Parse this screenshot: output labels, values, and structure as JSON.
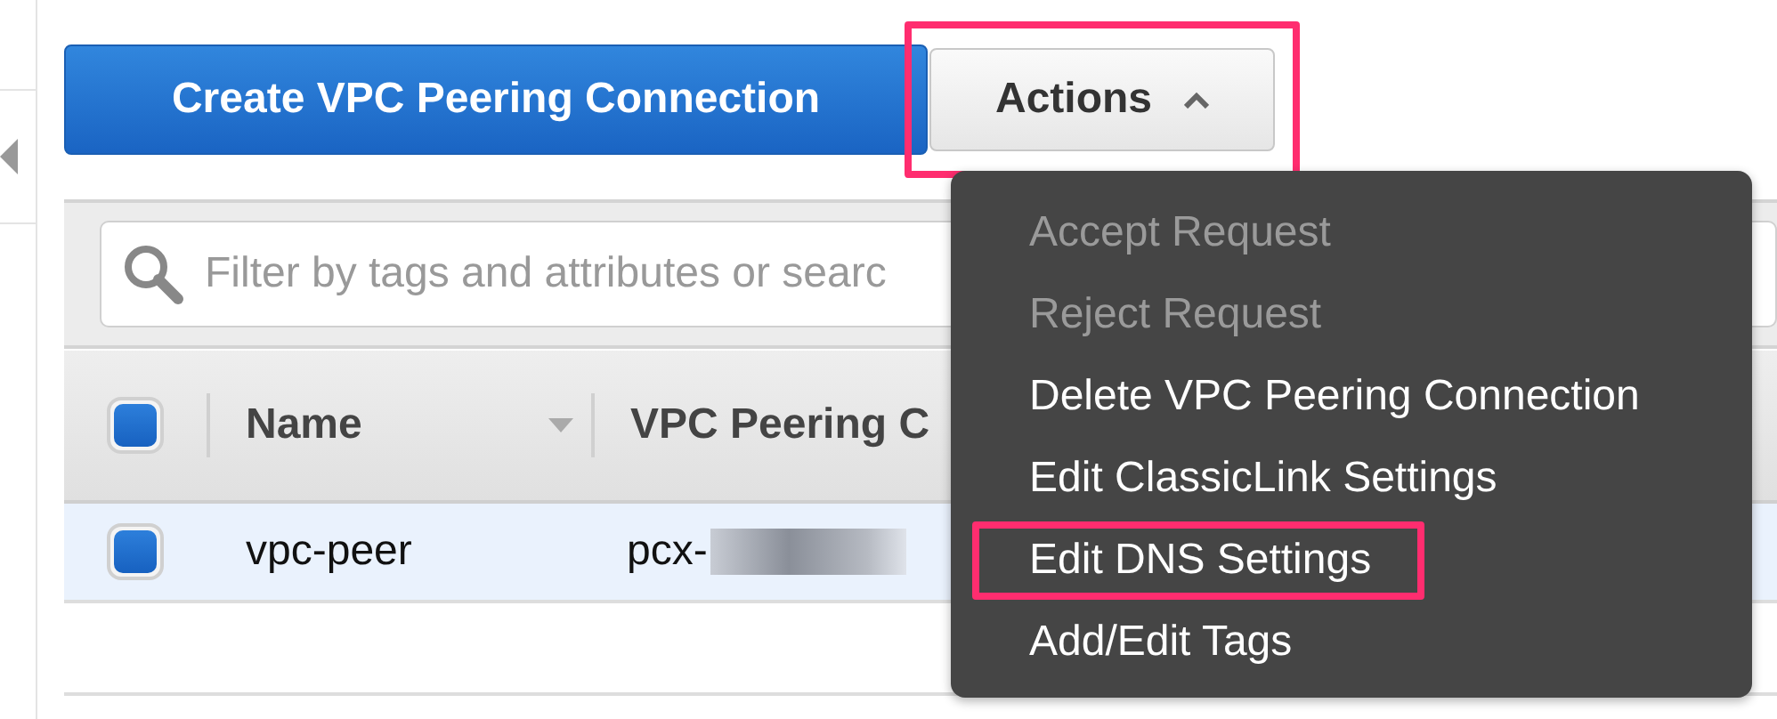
{
  "toolbar": {
    "create_button": "Create VPC Peering Connection",
    "actions_button": {
      "label": "Actions",
      "expanded": true,
      "highlighted": true
    }
  },
  "filter": {
    "placeholder": "Filter by tags and attributes or searc"
  },
  "table": {
    "select_all_checked": true,
    "columns": [
      {
        "label": "Name",
        "sortable": true
      },
      {
        "label": "VPC Peering C",
        "sortable": false
      }
    ],
    "rows": [
      {
        "selected": true,
        "checked": true,
        "cells": [
          "vpc-peer",
          "pcx-"
        ]
      }
    ]
  },
  "actions_menu": [
    {
      "label": "Accept Request",
      "disabled": true,
      "highlighted": false
    },
    {
      "label": "Reject Request",
      "disabled": true,
      "highlighted": false
    },
    {
      "label": "Delete VPC Peering Connection",
      "disabled": false,
      "highlighted": false
    },
    {
      "label": "Edit ClassicLink Settings",
      "disabled": false,
      "highlighted": false
    },
    {
      "label": "Edit DNS Settings",
      "disabled": false,
      "highlighted": true
    },
    {
      "label": "Add/Edit Tags",
      "disabled": false,
      "highlighted": false
    }
  ]
}
